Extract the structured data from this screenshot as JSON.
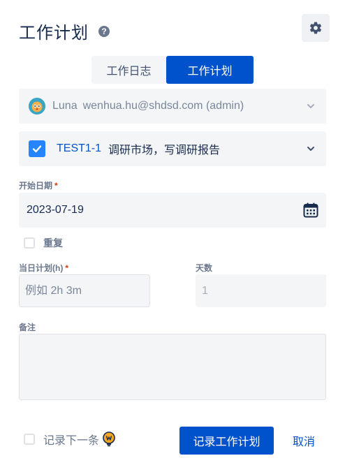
{
  "header": {
    "title": "工作计划",
    "help_glyph": "?"
  },
  "tabs": [
    {
      "label": "工作日志",
      "active": false
    },
    {
      "label": "工作计划",
      "active": true
    }
  ],
  "user_select": {
    "name": "Luna",
    "email": "wenhua.hu@shdsd.com (admin)"
  },
  "task_select": {
    "checked": true,
    "key": "TEST1-1",
    "summary": "调研市场，写调研报告"
  },
  "start_date": {
    "label": "开始日期",
    "required_mark": "*",
    "value": "2023-07-19"
  },
  "repeat": {
    "label": "重复",
    "checked": false
  },
  "daily_hours": {
    "label": "当日计划(h)",
    "required_mark": "*",
    "placeholder": "例如 2h 3m"
  },
  "days": {
    "label": "天数",
    "value": "1"
  },
  "notes": {
    "label": "备注",
    "value": ""
  },
  "footer": {
    "record_next_label": "记录下一条",
    "submit_label": "记录工作计划",
    "cancel_label": "取消"
  },
  "icons": {
    "settings": "gear-icon",
    "help": "question-circle-icon",
    "chevron": "chevron-down-icon",
    "calendar": "calendar-icon",
    "bulb": "lightbulb-icon"
  },
  "colors": {
    "primary": "#0052cc",
    "checkbox": "#2684ff",
    "field_bg": "#f4f5f7",
    "required": "#de350b",
    "bulb": "#f5a623"
  }
}
